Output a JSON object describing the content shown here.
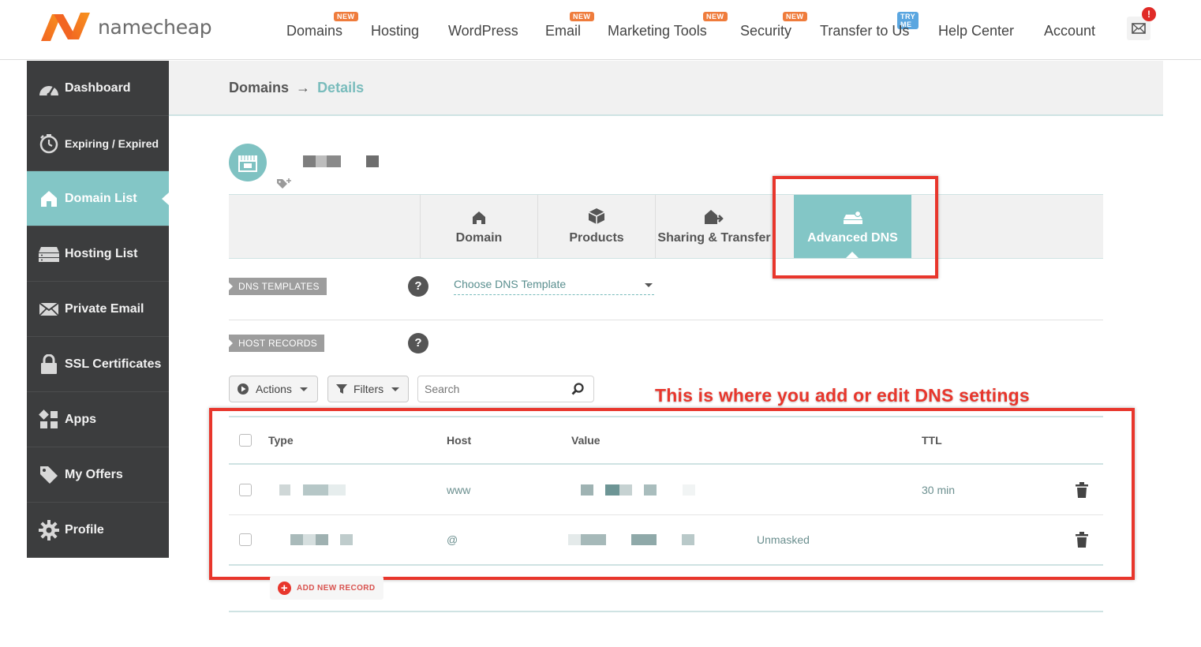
{
  "brand": {
    "name": "namecheap",
    "colors": {
      "orange": "#f26522",
      "teal": "#83c6c6",
      "annotation_red": "#e8362c"
    }
  },
  "nav": {
    "items": [
      {
        "label": "Domains",
        "badge": "NEW"
      },
      {
        "label": "Hosting",
        "badge": ""
      },
      {
        "label": "WordPress",
        "badge": ""
      },
      {
        "label": "Email",
        "badge": "NEW"
      },
      {
        "label": "Marketing Tools",
        "badge": "NEW"
      },
      {
        "label": "Security",
        "badge": "NEW"
      },
      {
        "label": "Transfer to Us",
        "badge": "TRY ME"
      },
      {
        "label": "Help Center",
        "badge": ""
      },
      {
        "label": "Account",
        "badge": ""
      }
    ],
    "mail_icon": "envelope-icon",
    "mail_alert": "!"
  },
  "sidebar": {
    "items": [
      {
        "label": "Dashboard",
        "icon": "gauge-icon"
      },
      {
        "label": "Expiring / Expired",
        "icon": "stopwatch-icon"
      },
      {
        "label": "Domain List",
        "icon": "home-icon",
        "active": true
      },
      {
        "label": "Hosting List",
        "icon": "server-icon"
      },
      {
        "label": "Private Email",
        "icon": "envelope-icon"
      },
      {
        "label": "SSL Certificates",
        "icon": "lock-icon"
      },
      {
        "label": "Apps",
        "icon": "apps-icon"
      },
      {
        "label": "My Offers",
        "icon": "tag-icon"
      },
      {
        "label": "Profile",
        "icon": "gear-icon"
      }
    ]
  },
  "breadcrumb": {
    "root": "Domains",
    "arrow": "→",
    "current": "Details"
  },
  "tabs": [
    {
      "label": "Domain",
      "icon": "home-icon"
    },
    {
      "label": "Products",
      "icon": "box-icon"
    },
    {
      "label": "Sharing & Transfer",
      "icon": "share-icon"
    },
    {
      "label": "Advanced DNS",
      "icon": "router-icon",
      "active": true
    }
  ],
  "dns_templates": {
    "label": "DNS TEMPLATES",
    "help": "?",
    "placeholder": "Choose DNS Template"
  },
  "host_records": {
    "label": "HOST RECORDS",
    "help": "?"
  },
  "toolbar": {
    "actions_label": "Actions",
    "filters_label": "Filters",
    "search_placeholder": "Search"
  },
  "annotation": {
    "text": "This is where you add or edit DNS settings"
  },
  "table": {
    "headers": {
      "type": "Type",
      "host": "Host",
      "value": "Value",
      "ttl": "TTL"
    },
    "rows": [
      {
        "host": "www",
        "extra": "",
        "ttl": "30 min"
      },
      {
        "host": "@",
        "extra": "Unmasked",
        "ttl": ""
      }
    ]
  },
  "add_record_label": "ADD NEW RECORD"
}
